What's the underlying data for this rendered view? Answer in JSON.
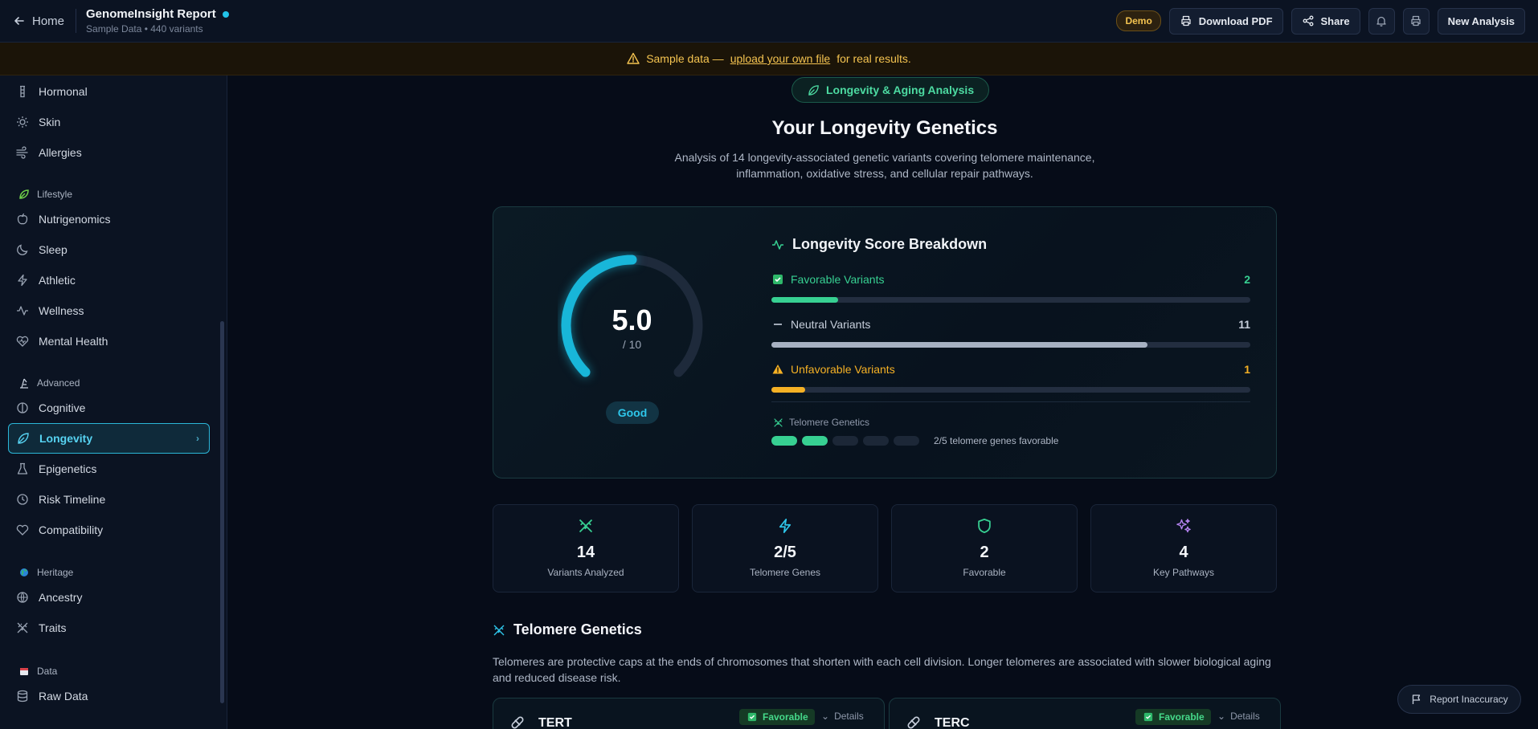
{
  "topbar": {
    "home_label": "Home",
    "report_title": "GenomeInsight Report",
    "report_subtitle": "Sample Data • 440 variants",
    "demo_badge": "Demo",
    "download_label": "Download PDF",
    "share_label": "Share",
    "new_analysis_label": "New Analysis"
  },
  "banner": {
    "prefix": "Sample data —",
    "link": "upload your own file",
    "suffix": "for real results."
  },
  "sidebar": {
    "items_top": [
      {
        "label": "Hormonal",
        "icon": "flask-icon"
      },
      {
        "label": "Skin",
        "icon": "sun-icon"
      },
      {
        "label": "Allergies",
        "icon": "wind-icon"
      }
    ],
    "sections": {
      "lifestyle": "Lifestyle",
      "advanced": "Advanced",
      "heritage": "Heritage",
      "data": "Data"
    },
    "lifestyle_items": [
      {
        "label": "Nutrigenomics",
        "icon": "apple-icon"
      },
      {
        "label": "Sleep",
        "icon": "moon-icon"
      },
      {
        "label": "Athletic",
        "icon": "bolt-icon"
      },
      {
        "label": "Wellness",
        "icon": "pulse-icon"
      },
      {
        "label": "Mental Health",
        "icon": "heart-brain-icon"
      }
    ],
    "advanced_items": [
      {
        "label": "Cognitive",
        "icon": "brain-icon"
      },
      {
        "label": "Longevity",
        "icon": "leaf-icon",
        "active": true
      },
      {
        "label": "Epigenetics",
        "icon": "beaker-icon"
      },
      {
        "label": "Risk Timeline",
        "icon": "clock-icon"
      },
      {
        "label": "Compatibility",
        "icon": "heart-icon"
      }
    ],
    "heritage_items": [
      {
        "label": "Ancestry",
        "icon": "globe-icon"
      },
      {
        "label": "Traits",
        "icon": "dna-icon"
      }
    ],
    "data_items": [
      {
        "label": "Raw Data",
        "icon": "database-icon"
      }
    ]
  },
  "main": {
    "pill": "Longevity & Aging Analysis",
    "title": "Your Longevity Genetics",
    "description": "Analysis of 14 longevity-associated genetic variants covering telomere maintenance, inflammation, oxidative stress, and cellular repair pathways.",
    "score": {
      "value": "5.0",
      "max": "/ 10",
      "fraction": 0.5,
      "rating": "Good"
    },
    "breakdown": {
      "title": "Longevity Score Breakdown",
      "rows": [
        {
          "label": "Favorable Variants",
          "count": "2",
          "fraction": 0.14,
          "color": "#37d092"
        },
        {
          "label": "Neutral Variants",
          "count": "11",
          "fraction": 0.786,
          "color": "#a7b1c2"
        },
        {
          "label": "Unfavorable Variants",
          "count": "1",
          "fraction": 0.071,
          "color": "#f5b125"
        }
      ],
      "telomere_label": "Telomere Genetics",
      "telomere_favorable": 2,
      "telomere_total": 5,
      "telomere_text": "2/5 telomere genes favorable"
    },
    "stats": [
      {
        "value": "14",
        "label": "Variants Analyzed",
        "icon": "dna-icon",
        "color": "#37d092"
      },
      {
        "value": "2/5",
        "label": "Telomere Genes",
        "icon": "bolt-icon",
        "color": "#2ec6ea"
      },
      {
        "value": "2",
        "label": "Favorable",
        "icon": "shield-icon",
        "color": "#37d092"
      },
      {
        "value": "4",
        "label": "Key Pathways",
        "icon": "sparkles-icon",
        "color": "#b583f0"
      }
    ],
    "telomere_section": {
      "title": "Telomere Genetics",
      "description": "Telomeres are protective caps at the ends of chromosomes that shorten with each cell division. Longer telomeres are associated with slower biological aging and reduced disease risk."
    },
    "genes": [
      {
        "name": "TERT",
        "badge": "Favorable",
        "details": "Details"
      },
      {
        "name": "TERC",
        "badge": "Favorable",
        "details": "Details"
      }
    ]
  },
  "report_inaccuracy": "Report Inaccuracy"
}
